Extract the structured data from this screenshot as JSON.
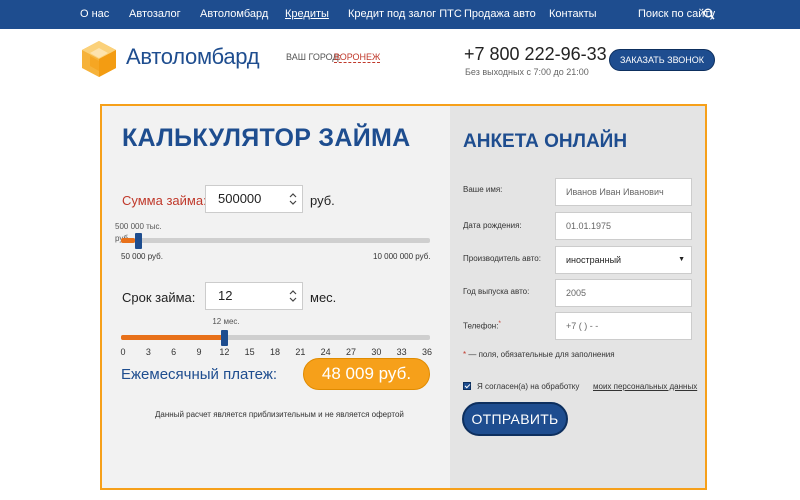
{
  "nav": {
    "items": [
      {
        "label": "О нас",
        "active": false
      },
      {
        "label": "Автозалог",
        "active": false
      },
      {
        "label": "Автоломбард",
        "active": false
      },
      {
        "label": "Кредиты",
        "active": true
      },
      {
        "label": "Кредит под залог ПТС",
        "active": false
      },
      {
        "label": "Продажа авто",
        "active": false
      },
      {
        "label": "Контакты",
        "active": false
      }
    ],
    "search_label": "Поиск по сайту",
    "search_icon": "search-icon"
  },
  "header": {
    "logo_text": "Автоломбард",
    "city_label": "ВАШ ГОРОД:",
    "city_value": "ВОРОНЕЖ",
    "phone": "+7 800 222-96-33",
    "hours": "Без выходных с 7:00 до 21:00",
    "callback_label": "ЗАКАЗАТЬ ЗВОНОК"
  },
  "calculator": {
    "title": "КАЛЬКУЛЯТОР ЗАЙМА",
    "amount_label": "Сумма займа:",
    "amount_value": "500000",
    "amount_unit": "руб.",
    "amount_tooltip_1": "500 000 тыс.",
    "amount_tooltip_2": "руб.",
    "amount_min_label": "50 000 руб.",
    "amount_max_label": "10 000 000 руб.",
    "amount_min": 50000,
    "amount_max": 10000000,
    "amount_current": 500000,
    "term_label": "Срок займа:",
    "term_value": "12",
    "term_unit": "мес.",
    "term_tooltip": "12 мес.",
    "term_ticks": [
      "0",
      "3",
      "6",
      "9",
      "12",
      "15",
      "18",
      "21",
      "24",
      "27",
      "30",
      "33",
      "36"
    ],
    "term_min": 0,
    "term_max": 36,
    "term_current": 12,
    "monthly_label": "Ежемесячный платеж:",
    "monthly_value": "48 009 руб.",
    "disclaimer": "Данный расчет является приблизительным и не является офертой"
  },
  "form": {
    "title": "АНКЕТА ОНЛАЙН",
    "fields": {
      "name": {
        "label": "Ваше имя:",
        "placeholder": "Иванов Иван Иванович"
      },
      "birth": {
        "label": "Дата рождения:",
        "placeholder": "01.01.1975"
      },
      "maker": {
        "label": "Производитель авто:",
        "value": "иностранный"
      },
      "year": {
        "label": "Год выпуска авто:",
        "placeholder": "2005"
      },
      "phone": {
        "label": "Телефон:",
        "placeholder": "+7 (   )    -   -"
      }
    },
    "required_note": "— поля, обязательные для заполнения",
    "agree_text": "Я согласен(а) на обработку",
    "agree_link": "моих персональных данных",
    "agree_checked": true,
    "submit_label": "ОТПРАВИТЬ"
  },
  "colors": {
    "brand_blue": "#1e4d8f",
    "accent_orange": "#f6a01a",
    "slider_fill": "#e8711a",
    "required_red": "#c0392b"
  }
}
